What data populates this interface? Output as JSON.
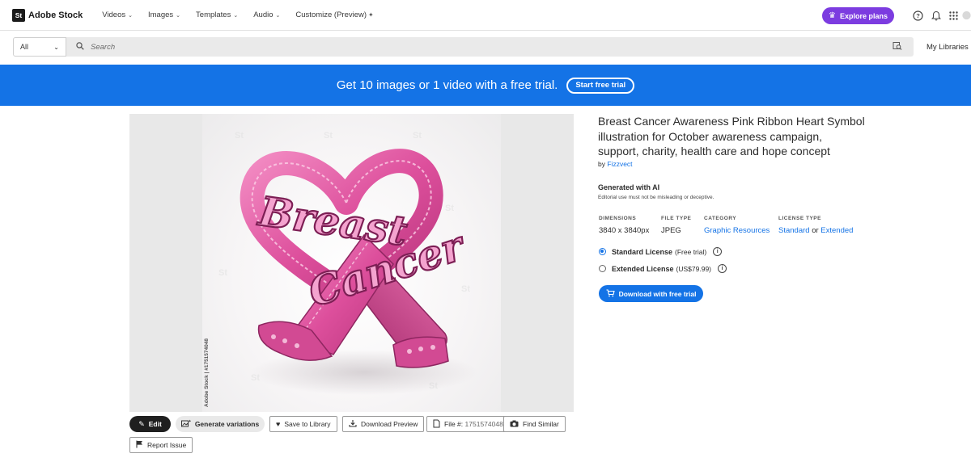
{
  "brand": {
    "logo": "St",
    "name": "Adobe Stock"
  },
  "nav": {
    "items": [
      {
        "label": "Videos"
      },
      {
        "label": "Images"
      },
      {
        "label": "Templates"
      },
      {
        "label": "Audio"
      }
    ],
    "customize_label": "Customize (Preview)",
    "explore_label": "Explore plans"
  },
  "icons": {
    "help": "help-icon",
    "bell": "bell-icon",
    "apps": "apps-grid-icon",
    "avatar": "avatar-icon",
    "crown": "crown-icon",
    "search": "search-icon",
    "visual_search": "visual-search-icon"
  },
  "search": {
    "scope": "All",
    "placeholder": "Search",
    "value": "",
    "my_libraries": "My Libraries"
  },
  "banner": {
    "text": "Get 10 images or 1 video with a free trial.",
    "button": "Start free trial"
  },
  "image": {
    "watermark": "Adobe Stock | #1751574048",
    "ribbon_words": [
      "Breast",
      "Cancer"
    ]
  },
  "actions": {
    "edit": "Edit",
    "generate": "Generate variations",
    "save": "Save to Library",
    "download_preview": "Download Preview",
    "file_label": "File #:",
    "file_id": "1751574048",
    "find_similar": "Find Similar",
    "report": "Report Issue"
  },
  "details": {
    "title": "Breast Cancer Awareness Pink Ribbon Heart Symbol illustration for October awareness campaign, support, charity, health care and hope concept",
    "by": "by",
    "author": "Fizzvect",
    "ai_title": "Generated with AI",
    "ai_note": "Editorial use must not be misleading or deceptive.",
    "meta": {
      "dimensions_label": "DIMENSIONS",
      "dimensions": "3840 x 3840px",
      "filetype_label": "FILE TYPE",
      "filetype": "JPEG",
      "category_label": "CATEGORY",
      "category": "Graphic Resources",
      "license_label": "LICENSE TYPE",
      "license_standard": "Standard",
      "license_or": "or",
      "license_extended": "Extended"
    },
    "licenses": [
      {
        "name": "Standard License",
        "price": "(Free trial)",
        "selected": true
      },
      {
        "name": "Extended License",
        "price": "(US$79.99)",
        "selected": false
      }
    ],
    "download_button": "Download with free trial"
  },
  "colors": {
    "accent_blue": "#1473e6",
    "explore_purple": "#7c3ce0",
    "ribbon_pink": "#e0569f"
  }
}
